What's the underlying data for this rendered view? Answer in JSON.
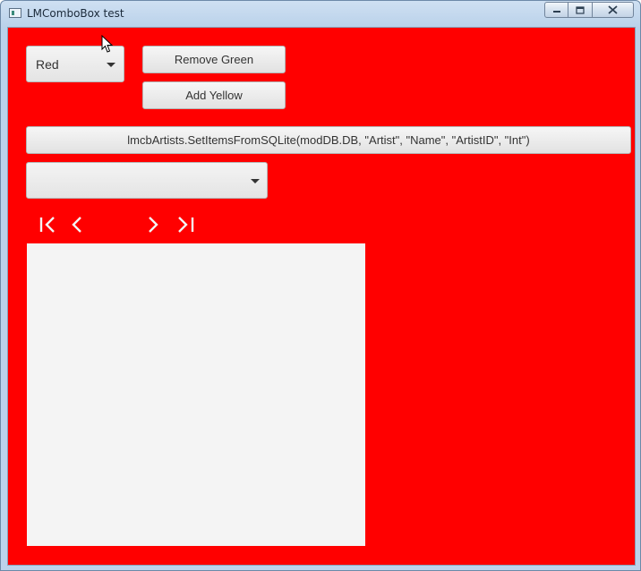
{
  "window": {
    "title": "LMComboBox test",
    "controls": {
      "minimize_icon": "minimize-icon",
      "maximize_icon": "maximize-icon",
      "close_icon": "close-icon"
    }
  },
  "colors": {
    "client_background": "#ff0000",
    "control_face": "#e8e8e8",
    "list_background": "#f4f4f4"
  },
  "form": {
    "color_combo": {
      "value": "Red"
    },
    "remove_green_label": "Remove Green",
    "add_yellow_label": "Add Yellow",
    "sql_button_label": "lmcbArtists.SetItemsFromSQLite(modDB.DB, \"Artist\", \"Name\", \"ArtistID\", \"Int\")",
    "artist_combo": {
      "value": ""
    },
    "navigator": {
      "first_icon": "first-page-icon",
      "prev_icon": "previous-page-icon",
      "next_icon": "next-page-icon",
      "last_icon": "last-page-icon"
    }
  }
}
